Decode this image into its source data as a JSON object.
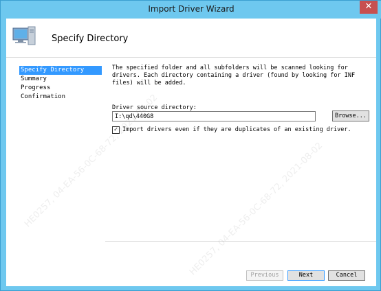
{
  "window": {
    "title": "Import Driver Wizard",
    "close_glyph": "✕"
  },
  "banner": {
    "title": "Specify Directory",
    "icon": "computer-icon"
  },
  "nav": {
    "items": [
      {
        "label": "Specify Directory",
        "selected": true
      },
      {
        "label": "Summary",
        "selected": false
      },
      {
        "label": "Progress",
        "selected": false
      },
      {
        "label": "Confirmation",
        "selected": false
      }
    ]
  },
  "main": {
    "description": "The specified folder and all subfolders will be scanned looking for drivers.  Each directory containing a driver (found by looking for INF files) will be added.",
    "source_label": "Driver source directory:",
    "source_value": "I:\\qd\\440G8",
    "browse_label": "Browse...",
    "checkbox_checked": true,
    "checkbox_mark": "✓",
    "checkbox_label": "Import drivers even if they are duplicates of an existing driver."
  },
  "footer": {
    "previous_label": "Previous",
    "next_label": "Next",
    "cancel_label": "Cancel"
  },
  "watermark": {
    "text1": "HE0257, 04-EA-56-0C-68-72, 2021-08-02",
    "text2": "HE0257, 04-EA-56-0C-68-72, 2021-08-02"
  },
  "colors": {
    "titlebar": "#6ec8ef",
    "selection": "#3399ff",
    "close": "#c75050"
  }
}
